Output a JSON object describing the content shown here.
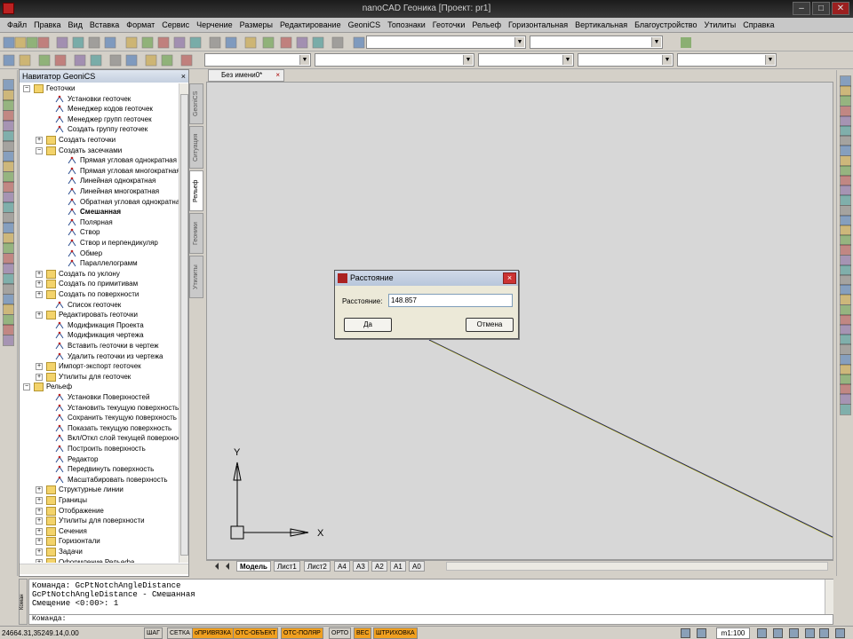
{
  "window": {
    "title": "nanoCAD Геоника [Проект: pr1]"
  },
  "menu": [
    "Файл",
    "Правка",
    "Вид",
    "Вставка",
    "Формат",
    "Сервис",
    "Черчение",
    "Размеры",
    "Редактирование",
    "GeoniCS",
    "Топознаки",
    "Геоточки",
    "Рельеф",
    "Горизонтальная",
    "Вертикальная",
    "Благоустройство",
    "Утилиты",
    "Справка"
  ],
  "navigator": {
    "title": "Навигатор GeoniCS",
    "close": "×",
    "items": [
      {
        "label": "Геоточки",
        "level": 0,
        "type": "folder",
        "expander": "−"
      },
      {
        "label": "Установки геоточек",
        "level": 1,
        "type": "tool"
      },
      {
        "label": "Менеджер кодов геоточек",
        "level": 1,
        "type": "tool"
      },
      {
        "label": "Менеджер групп геоточек",
        "level": 1,
        "type": "tool"
      },
      {
        "label": "Создать группу геоточек",
        "level": 1,
        "type": "tool"
      },
      {
        "label": "Создать геоточки",
        "level": 1,
        "type": "folder",
        "expander": "+"
      },
      {
        "label": "Создать засечками",
        "level": 1,
        "type": "folder",
        "expander": "−"
      },
      {
        "label": "Прямая угловая однократная",
        "level": 2,
        "type": "tool"
      },
      {
        "label": "Прямая угловая многократная",
        "level": 2,
        "type": "tool"
      },
      {
        "label": "Линейная однократная",
        "level": 2,
        "type": "tool"
      },
      {
        "label": "Линейная многократная",
        "level": 2,
        "type": "tool"
      },
      {
        "label": "Обратная угловая однократна",
        "level": 2,
        "type": "tool"
      },
      {
        "label": "Смешанная",
        "level": 2,
        "type": "tool",
        "bold": true
      },
      {
        "label": "Полярная",
        "level": 2,
        "type": "tool"
      },
      {
        "label": "Створ",
        "level": 2,
        "type": "tool"
      },
      {
        "label": "Створ и перпендикуляр",
        "level": 2,
        "type": "tool"
      },
      {
        "label": "Обмер",
        "level": 2,
        "type": "tool"
      },
      {
        "label": "Параллелограмм",
        "level": 2,
        "type": "tool"
      },
      {
        "label": "Создать по уклону",
        "level": 1,
        "type": "folder",
        "expander": "+"
      },
      {
        "label": "Создать по примитивам",
        "level": 1,
        "type": "folder",
        "expander": "+"
      },
      {
        "label": "Создать по поверхности",
        "level": 1,
        "type": "folder",
        "expander": "+"
      },
      {
        "label": "Список геоточек",
        "level": 1,
        "type": "tool"
      },
      {
        "label": "Редактировать геоточки",
        "level": 1,
        "type": "folder",
        "expander": "+"
      },
      {
        "label": "Модификация Проекта",
        "level": 1,
        "type": "tool"
      },
      {
        "label": "Модификация чертежа",
        "level": 1,
        "type": "tool"
      },
      {
        "label": "Вставить геоточки в чертеж",
        "level": 1,
        "type": "tool"
      },
      {
        "label": "Удалить геоточки из чертежа",
        "level": 1,
        "type": "tool"
      },
      {
        "label": "Импорт-экспорт геоточек",
        "level": 1,
        "type": "folder",
        "expander": "+"
      },
      {
        "label": "Утилиты для геоточек",
        "level": 1,
        "type": "folder",
        "expander": "+"
      },
      {
        "label": "Рельеф",
        "level": 0,
        "type": "folder",
        "expander": "−"
      },
      {
        "label": "Установки Поверхностей",
        "level": 1,
        "type": "tool"
      },
      {
        "label": "Установить текущую поверхность",
        "level": 1,
        "type": "tool"
      },
      {
        "label": "Сохранить текущую поверхность",
        "level": 1,
        "type": "tool"
      },
      {
        "label": "Показать текущую поверхность",
        "level": 1,
        "type": "tool"
      },
      {
        "label": "Вкл/Откл слой текущей поверхнос",
        "level": 1,
        "type": "tool"
      },
      {
        "label": "Построить поверхность",
        "level": 1,
        "type": "tool"
      },
      {
        "label": "Редактор",
        "level": 1,
        "type": "tool"
      },
      {
        "label": "Передвинуть поверхность",
        "level": 1,
        "type": "tool"
      },
      {
        "label": "Масштабировать поверхность",
        "level": 1,
        "type": "tool"
      },
      {
        "label": "Структурные линии",
        "level": 1,
        "type": "folder",
        "expander": "+"
      },
      {
        "label": "Границы",
        "level": 1,
        "type": "folder",
        "expander": "+"
      },
      {
        "label": "Отображение",
        "level": 1,
        "type": "folder",
        "expander": "+"
      },
      {
        "label": "Утилиты для поверхности",
        "level": 1,
        "type": "folder",
        "expander": "+"
      },
      {
        "label": "Сечения",
        "level": 1,
        "type": "folder",
        "expander": "+"
      },
      {
        "label": "Горизонтали",
        "level": 1,
        "type": "folder",
        "expander": "+"
      },
      {
        "label": "Задачи",
        "level": 1,
        "type": "folder",
        "expander": "+"
      },
      {
        "label": "Оформление Рельефа",
        "level": 1,
        "type": "folder",
        "expander": "+"
      }
    ]
  },
  "vertical_tabs": [
    "GeoniCS",
    "Ситуация",
    "Рельеф",
    "Геоники",
    "Утилиты"
  ],
  "document_tab": {
    "label": "Без имени0*",
    "close": "×"
  },
  "layout_tabs": [
    "Модель",
    "Лист1",
    "Лист2",
    "A4",
    "A3",
    "A2",
    "A1",
    "A0"
  ],
  "ucs": {
    "x_label": "X",
    "y_label": "Y"
  },
  "dialog": {
    "title": "Расстояние",
    "field_label": "Расстояние:",
    "value": "148.857",
    "ok": "Да",
    "cancel": "Отмена",
    "close": "×"
  },
  "command_history": [
    "Команда: GcPtNotchAngleDistance",
    "GcPtNotchAngleDistance - Смешанная",
    "Смещение <0:00>: 1"
  ],
  "command_prompt": "Команда:",
  "command_side_label": "Коман",
  "status": {
    "coords": "24664.31,35249.14,0.00",
    "buttons": [
      {
        "label": "ШАГ",
        "on": false
      },
      {
        "label": "СЕТКА",
        "on": false
      },
      {
        "label": "оПРИВЯЗКА",
        "on": true
      },
      {
        "label": "ОТС-ОБЪЕКТ",
        "on": true
      },
      {
        "label": "ОТС-ПОЛЯР",
        "on": true
      },
      {
        "label": "ОРТО",
        "on": false
      },
      {
        "label": "ВЕС",
        "on": true
      },
      {
        "label": "ШТРИХОВКА",
        "on": true
      }
    ],
    "scale": "m1:100"
  },
  "colors": {
    "accent_on": "#f0a020",
    "menu_highlight": "#316ac5",
    "canvas": "#d7d7d7",
    "line": "#1f1f55"
  }
}
